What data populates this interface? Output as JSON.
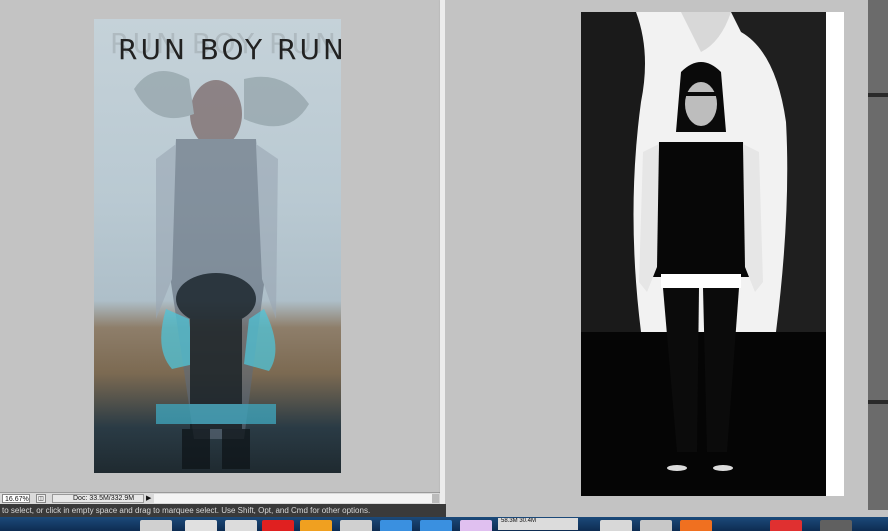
{
  "poster": {
    "title": "RUN BOY RUN",
    "title_shadow": "RUN BOY RUN"
  },
  "status_bar": {
    "zoom": "16.67%",
    "doc_size": "Doc: 33.5M/332.9M",
    "menu_arrow": "▶"
  },
  "hint_bar": {
    "text": "to select, or click in empty space and drag to marquee select. Use Shift, Opt, and Cmd for other options."
  },
  "dock": {
    "readout": "58.3M 30.4M",
    "colors": [
      "#d0d0d0",
      "#e0e0e0",
      "#dcdcdc",
      "#e02020",
      "#f0a020",
      "#d0d0d0",
      "#3a90e0",
      "#3a90e0",
      "#e0c0f0",
      "#d8d8d8",
      "#c8c8c8",
      "#f07020",
      "#e03030",
      "#606060"
    ]
  },
  "colors": {
    "canvas_bg": "#c3c3c3",
    "hint_bar_bg": "#3a3a3a",
    "dock_bg": "#14396a"
  }
}
